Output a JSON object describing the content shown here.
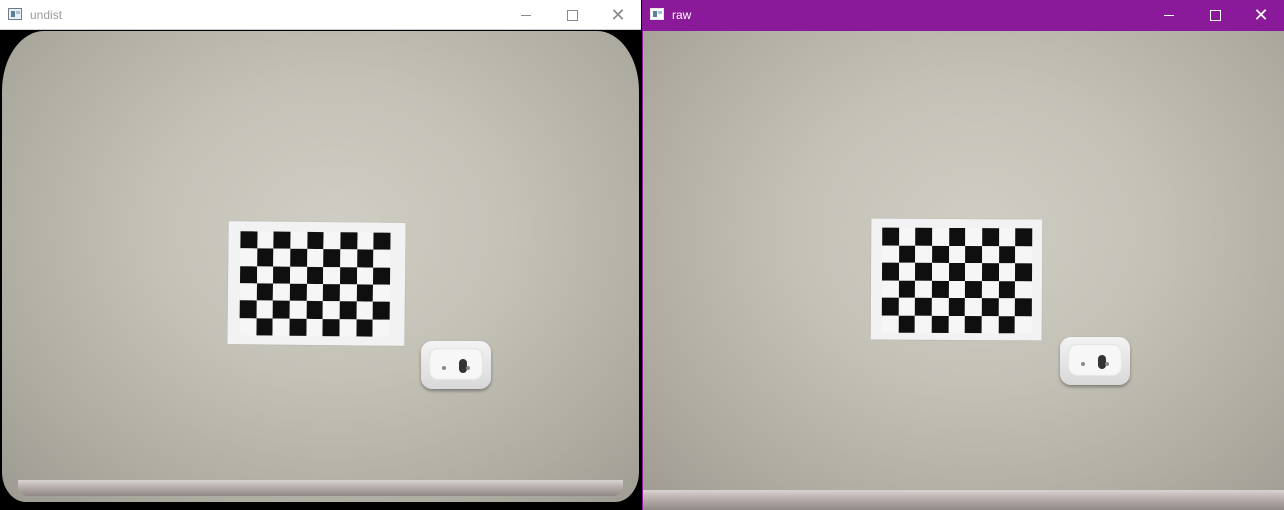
{
  "windows": [
    {
      "id": "undist",
      "title": "undist",
      "controls": {
        "minimize": "—",
        "maximize": "☐",
        "close": "✕"
      },
      "colors": {
        "titlebar_bg": "#ffffff",
        "titlebar_text": "#9a9a9a"
      }
    },
    {
      "id": "raw",
      "title": "raw",
      "controls": {
        "minimize": "—",
        "maximize": "☐",
        "close": "✕"
      },
      "colors": {
        "titlebar_bg": "#8a1a9a",
        "titlebar_text": "#ffffff"
      }
    }
  ],
  "chessboard": {
    "columns": 9,
    "rows": 6,
    "dark_color": "#0f0f10",
    "light_color": "#f6f6f6"
  }
}
